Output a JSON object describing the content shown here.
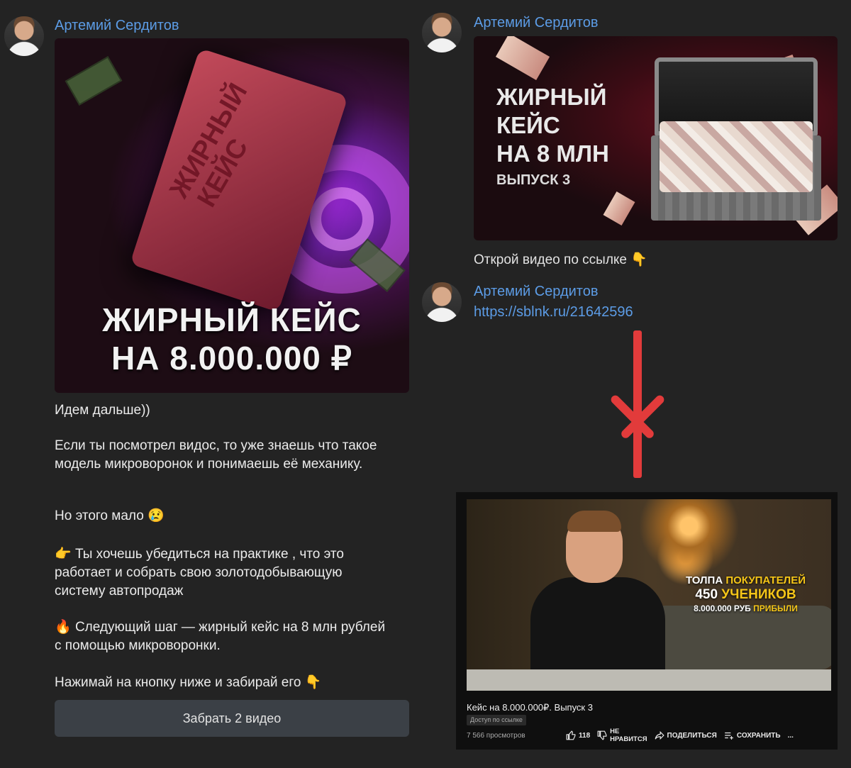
{
  "colors": {
    "background": "#232323",
    "author": "#5c9ce6",
    "arrow": "#e23b3b",
    "button_bg": "#3b4046"
  },
  "left_post": {
    "author": "Артемий Сердитов",
    "cover": {
      "box_label": "ЖИРНЫЙ КЕЙС",
      "headline_line1": "ЖИРНЫЙ КЕЙС",
      "headline_line2": "НА 8.000.000 ₽"
    },
    "paragraphs": {
      "p1": "Идем дальше))",
      "p2": "Если ты посмотрел видос, то уже знаешь что такое модель микроворонок и понимаешь её механику.",
      "p3": "Но этого мало",
      "p3_emoji": "😢",
      "p4_emoji": "👉",
      "p4": " Ты хочешь убедиться на практике , что это работает и собрать свою золотодобывающую систему автопродаж",
      "p5_emoji": "🔥",
      "p5": " Следующий шаг — жирный кейс на 8 млн рублей с помощью микроворонки.",
      "p6": "Нажимай на кнопку ниже и забирай его",
      "p6_emoji": "👇"
    },
    "button_label": "Забрать 2 видео"
  },
  "right_post": {
    "author": "Артемий Сердитов",
    "cover": {
      "line1": "ЖИРНЫЙ",
      "line2": "КЕЙС",
      "line3": "НА 8 МЛН",
      "subtitle": "ВЫПУСК 3"
    },
    "caption": "Открой видео по ссылке",
    "caption_emoji": "👇"
  },
  "link_post": {
    "author": "Артемий Сердитов",
    "url": "https://sblnk.ru/21642596"
  },
  "youtube": {
    "overlay": {
      "l1_a": "ТОЛПА ",
      "l1_b": "ПОКУПАТЕЛЕЙ",
      "l2_a": "450 ",
      "l2_b": "УЧЕНИКОВ",
      "l3_a": "8.000.000 РУБ ",
      "l3_b": "ПРИБЫЛИ"
    },
    "title": "Кейс на 8.000.000₽. Выпуск 3",
    "badge": "Доступ по ссылке",
    "views": "7 566 просмотров",
    "likes": "118",
    "dislike_label_1": "НЕ",
    "dislike_label_2": "НРАВИТСЯ",
    "share_label": "ПОДЕЛИТЬСЯ",
    "save_label": "СОХРАНИТЬ",
    "more_label": "..."
  }
}
